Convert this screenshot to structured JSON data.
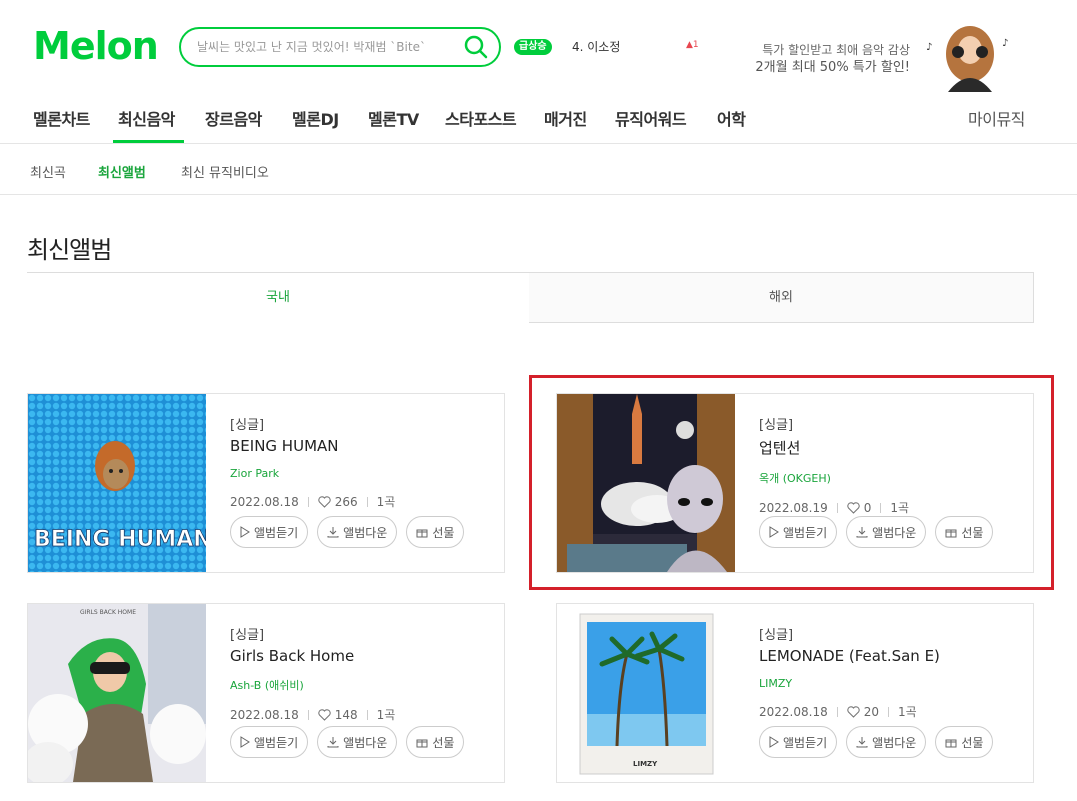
{
  "header": {
    "logo": "Melon",
    "search_placeholder": "날씨는 맛있고 난 지금 멋있어! 박재범 `Bite`",
    "rise_badge": "급상승",
    "rise_rank": "4. 이소정",
    "rise_change": "▲1",
    "promo_line1": "특가 할인받고 최애 음악 감상",
    "promo_line2": "2개월 최대 50% 특가 할인!"
  },
  "gnb": [
    "멜론차트",
    "최신음악",
    "장르음악",
    "멜론DJ",
    "멜론TV",
    "스타포스트",
    "매거진",
    "뮤직어워드",
    "어학",
    "마이뮤직"
  ],
  "subnav": [
    "최신곡",
    "최신앨범",
    "최신 뮤직비디오"
  ],
  "page_title": "최신앨범",
  "tabs": {
    "domestic": "국내",
    "international": "해외"
  },
  "button_labels": {
    "listen": "앨범듣기",
    "download": "앨범다운",
    "gift": "선물"
  },
  "albums": [
    {
      "type": "[싱글]",
      "title": "BEING HUMAN",
      "artist": "Zior Park",
      "date": "2022.08.18",
      "likes": "266",
      "tracks": "1곡",
      "cover_text": "BEING HUMAN"
    },
    {
      "type": "[싱글]",
      "title": "업텐션",
      "artist": "옥개 (OKGEH)",
      "date": "2022.08.19",
      "likes": "0",
      "tracks": "1곡"
    },
    {
      "type": "[싱글]",
      "title": "Girls Back Home",
      "artist": "Ash-B (애쉬비)",
      "date": "2022.08.18",
      "likes": "148",
      "tracks": "1곡",
      "cover_text": "GIRLS BACK HOME"
    },
    {
      "type": "[싱글]",
      "title": "LEMONADE (Feat.San E)",
      "artist": "LIMZY",
      "date": "2022.08.18",
      "likes": "20",
      "tracks": "1곡",
      "cover_text": "LIMZY"
    }
  ],
  "colors": {
    "brand": "#00cd3c",
    "highlight": "#d4202a"
  }
}
